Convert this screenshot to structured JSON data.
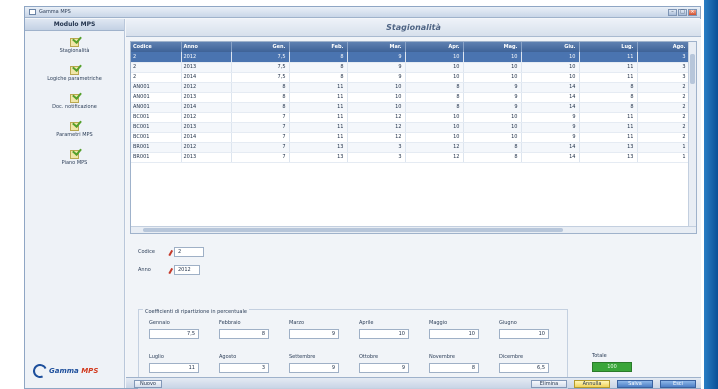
{
  "window": {
    "title": "Gamma MPS"
  },
  "sidebar": {
    "header": "Modulo MPS",
    "items": [
      {
        "label": "Stagionalità"
      },
      {
        "label": "Logiche parametriche"
      },
      {
        "label": "Doc. notificazione"
      },
      {
        "label": "Parametri MPS"
      },
      {
        "label": "Piano MPS"
      }
    ],
    "logo_text_1": "Gamma",
    "logo_text_2": "MPS"
  },
  "main": {
    "title": "Stagionalità"
  },
  "grid": {
    "columns": [
      "Codice",
      "Anno",
      "Gen.",
      "Feb.",
      "Mar.",
      "Apr.",
      "Mag.",
      "Giu.",
      "Lug.",
      "Ago."
    ],
    "rows": [
      [
        "2",
        "2012",
        "7,5",
        "8",
        "9",
        "10",
        "10",
        "10",
        "11",
        "3"
      ],
      [
        "2",
        "2013",
        "7,5",
        "8",
        "9",
        "10",
        "10",
        "10",
        "11",
        "3"
      ],
      [
        "2",
        "2014",
        "7,5",
        "8",
        "9",
        "10",
        "10",
        "10",
        "11",
        "3"
      ],
      [
        "AN001",
        "2012",
        "8",
        "11",
        "10",
        "8",
        "9",
        "14",
        "8",
        "2"
      ],
      [
        "AN001",
        "2013",
        "8",
        "11",
        "10",
        "8",
        "9",
        "14",
        "8",
        "2"
      ],
      [
        "AN001",
        "2014",
        "8",
        "11",
        "10",
        "8",
        "9",
        "14",
        "8",
        "2"
      ],
      [
        "BC001",
        "2012",
        "7",
        "11",
        "12",
        "10",
        "10",
        "9",
        "11",
        "2"
      ],
      [
        "BC001",
        "2013",
        "7",
        "11",
        "12",
        "10",
        "10",
        "9",
        "11",
        "2"
      ],
      [
        "BC001",
        "2014",
        "7",
        "11",
        "12",
        "10",
        "10",
        "9",
        "11",
        "2"
      ],
      [
        "BR001",
        "2012",
        "7",
        "13",
        "3",
        "12",
        "8",
        "14",
        "13",
        "1"
      ],
      [
        "BR001",
        "2013",
        "7",
        "13",
        "3",
        "12",
        "8",
        "14",
        "13",
        "1"
      ]
    ]
  },
  "form": {
    "codice_label": "Codice",
    "codice_value": "2",
    "anno_label": "Anno",
    "anno_value": "2012",
    "coef_title": "Coefficienti di ripartizione in percentuale",
    "months": [
      {
        "label": "Gennaio",
        "value": "7,5"
      },
      {
        "label": "Febbraio",
        "value": "8"
      },
      {
        "label": "Marzo",
        "value": "9"
      },
      {
        "label": "Aprile",
        "value": "10"
      },
      {
        "label": "Maggio",
        "value": "10"
      },
      {
        "label": "Giugno",
        "value": "10"
      },
      {
        "label": "Luglio",
        "value": "11"
      },
      {
        "label": "Agosto",
        "value": "3"
      },
      {
        "label": "Settembre",
        "value": "9"
      },
      {
        "label": "Ottobre",
        "value": "9"
      },
      {
        "label": "Novembre",
        "value": "8"
      },
      {
        "label": "Dicembre",
        "value": "6,5"
      }
    ],
    "total_label": "Totale",
    "total_value": "100"
  },
  "footer": {
    "left_button": "Nuovo",
    "buttons": [
      "Elimina",
      "Annulla",
      "Salva",
      "Esci"
    ]
  },
  "colors": {
    "selected_row": "#4a74b0",
    "header": "#3e6297",
    "total_ok": "#3aa53a",
    "accent_band": "#0a4f97"
  }
}
